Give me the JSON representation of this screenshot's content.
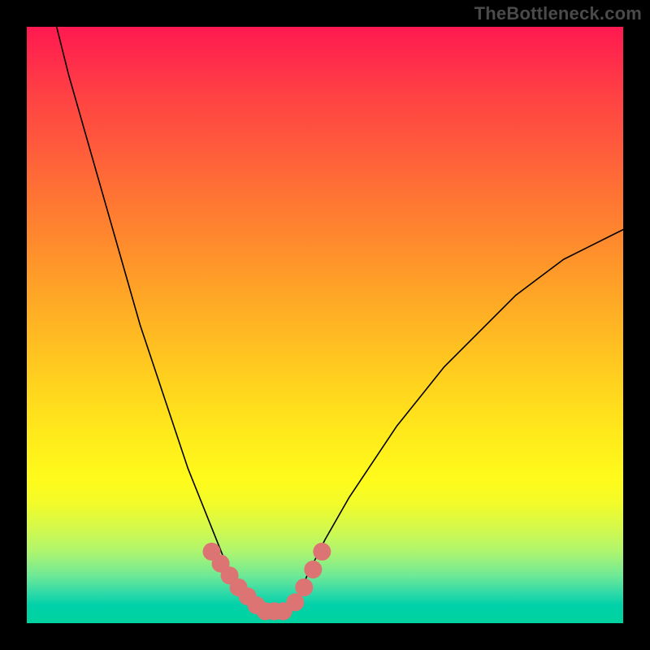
{
  "watermark": "TheBottleneck.com",
  "chart_data": {
    "type": "line",
    "title": "",
    "xlabel": "",
    "ylabel": "",
    "xlim": [
      0,
      100
    ],
    "ylim": [
      0,
      100
    ],
    "grid": false,
    "legend": false,
    "background_gradient": {
      "direction": "vertical",
      "stops": [
        {
          "pos": 0.0,
          "color": "#ff1950"
        },
        {
          "pos": 0.25,
          "color": "#ff6a37"
        },
        {
          "pos": 0.5,
          "color": "#ffb924"
        },
        {
          "pos": 0.72,
          "color": "#fff41b"
        },
        {
          "pos": 0.88,
          "color": "#aef56f"
        },
        {
          "pos": 1.0,
          "color": "#00d3a0"
        }
      ]
    },
    "series": [
      {
        "name": "left-curve",
        "stroke": "#000000",
        "stroke_width": 1.6,
        "x": [
          5,
          7,
          9,
          11,
          13,
          15,
          17,
          19,
          21,
          23,
          25,
          27,
          29,
          31,
          33,
          35,
          37.5
        ],
        "y": [
          100,
          92,
          85,
          78,
          71,
          64,
          57,
          50,
          44,
          38,
          32,
          26,
          21,
          16,
          11,
          7,
          3
        ]
      },
      {
        "name": "right-curve",
        "stroke": "#000000",
        "stroke_width": 1.6,
        "x": [
          45,
          47,
          50,
          54,
          58,
          62,
          66,
          70,
          74,
          78,
          82,
          86,
          90,
          94,
          98,
          100
        ],
        "y": [
          3,
          8,
          14,
          21,
          27,
          33,
          38,
          43,
          47,
          51,
          55,
          58,
          61,
          63,
          65,
          66
        ]
      },
      {
        "name": "valley-markers-left",
        "type": "scatter",
        "marker_color": "#dd7474",
        "marker_radius_pct": 1.5,
        "x": [
          31,
          32.5,
          34,
          35.5,
          37,
          38.5,
          40,
          41.5
        ],
        "y": [
          12,
          10,
          8,
          6,
          4.5,
          3,
          2,
          2
        ]
      },
      {
        "name": "valley-markers-right",
        "type": "scatter",
        "marker_color": "#dd7474",
        "marker_radius_pct": 1.5,
        "x": [
          43,
          45,
          46.5,
          48,
          49.5
        ],
        "y": [
          2,
          3.5,
          6,
          9,
          12
        ]
      }
    ]
  }
}
